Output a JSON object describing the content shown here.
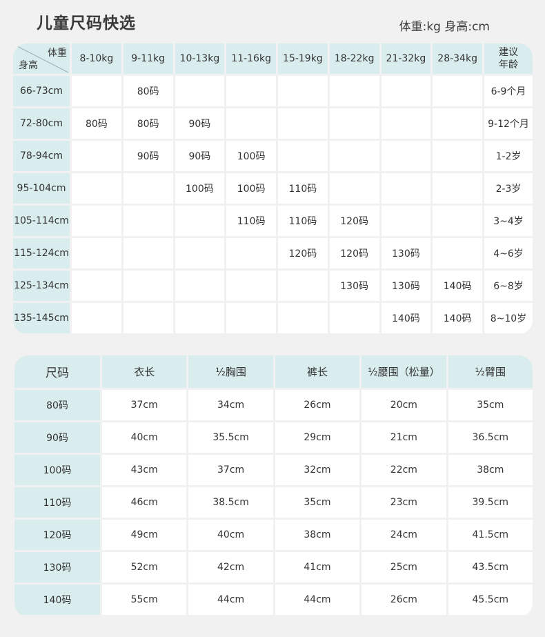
{
  "header": {
    "title": "儿童尺码快选",
    "unit_note": "体重:kg 身高:cm"
  },
  "quick_table": {
    "corner_weight": "体重",
    "corner_height": "身高",
    "weight_columns": [
      "8-10kg",
      "9-11kg",
      "10-13kg",
      "11-16kg",
      "15-19kg",
      "18-22kg",
      "21-32kg",
      "28-34kg"
    ],
    "age_header_line1": "建议",
    "age_header_line2": "年龄",
    "rows": [
      {
        "height": "66-73cm",
        "cells": [
          "",
          "80码",
          "",
          "",
          "",
          "",
          "",
          ""
        ],
        "age": "6-9个月"
      },
      {
        "height": "72-80cm",
        "cells": [
          "80码",
          "80码",
          "90码",
          "",
          "",
          "",
          "",
          ""
        ],
        "age": "9-12个月"
      },
      {
        "height": "78-94cm",
        "cells": [
          "",
          "90码",
          "90码",
          "100码",
          "",
          "",
          "",
          ""
        ],
        "age": "1-2岁"
      },
      {
        "height": "95-104cm",
        "cells": [
          "",
          "",
          "100码",
          "100码",
          "110码",
          "",
          "",
          ""
        ],
        "age": "2-3岁"
      },
      {
        "height": "105-114cm",
        "cells": [
          "",
          "",
          "",
          "110码",
          "110码",
          "120码",
          "",
          ""
        ],
        "age": "3~4岁"
      },
      {
        "height": "115-124cm",
        "cells": [
          "",
          "",
          "",
          "",
          "120码",
          "120码",
          "130码",
          ""
        ],
        "age": "4~6岁"
      },
      {
        "height": "125-134cm",
        "cells": [
          "",
          "",
          "",
          "",
          "",
          "130码",
          "130码",
          "140码"
        ],
        "age": "6~8岁"
      },
      {
        "height": "135-145cm",
        "cells": [
          "",
          "",
          "",
          "",
          "",
          "",
          "140码",
          "140码"
        ],
        "age": "8~10岁"
      }
    ]
  },
  "measure_table": {
    "columns": [
      "尺码",
      "衣长",
      "½胸围",
      "裤长",
      "½腰围（松量）",
      "½臂围"
    ],
    "rows": [
      [
        "80码",
        "37cm",
        "34cm",
        "26cm",
        "20cm",
        "35cm"
      ],
      [
        "90码",
        "40cm",
        "35.5cm",
        "29cm",
        "21cm",
        "36.5cm"
      ],
      [
        "100码",
        "43cm",
        "37cm",
        "32cm",
        "22cm",
        "38cm"
      ],
      [
        "110码",
        "46cm",
        "38.5cm",
        "35cm",
        "23cm",
        "39.5cm"
      ],
      [
        "120码",
        "49cm",
        "40cm",
        "38cm",
        "24cm",
        "41.5cm"
      ],
      [
        "130码",
        "52cm",
        "42cm",
        "41cm",
        "25cm",
        "43.5cm"
      ],
      [
        "140码",
        "55cm",
        "44cm",
        "44cm",
        "26cm",
        "45.5cm"
      ]
    ]
  },
  "colors": {
    "header_fill": "#d9ecee",
    "cell_fill": "#ffffff",
    "page_background": "#f1f1f1"
  }
}
